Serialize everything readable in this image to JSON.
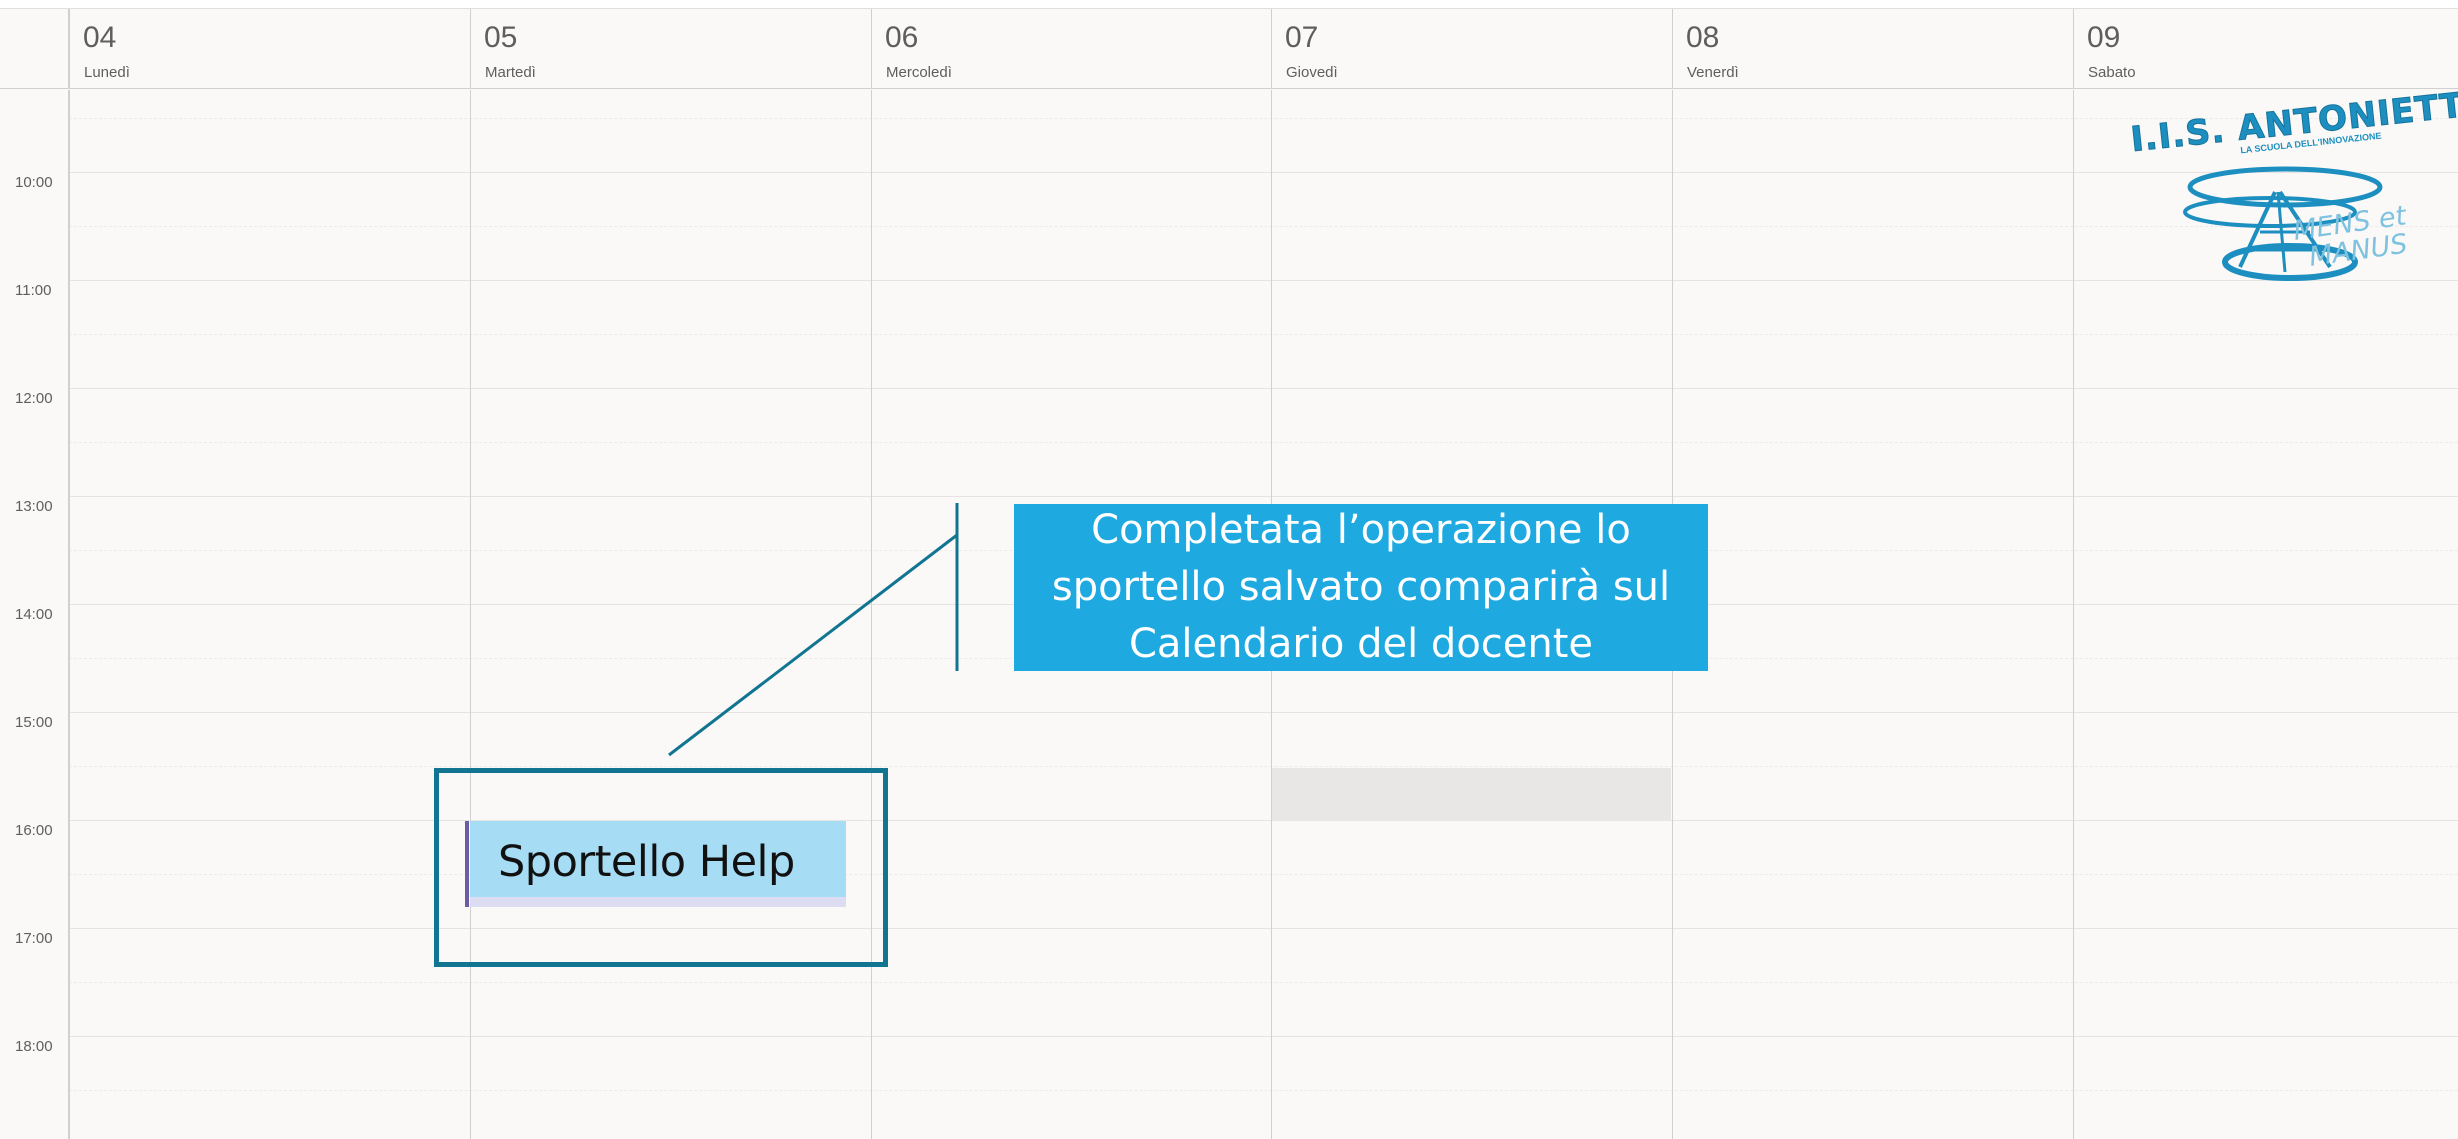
{
  "calendar": {
    "days": [
      {
        "num": "04",
        "name": "Lunedì"
      },
      {
        "num": "05",
        "name": "Martedì"
      },
      {
        "num": "06",
        "name": "Mercoledì"
      },
      {
        "num": "07",
        "name": "Giovedì"
      },
      {
        "num": "08",
        "name": "Venerdì"
      },
      {
        "num": "09",
        "name": "Sabato"
      }
    ],
    "hours": [
      "10:00",
      "11:00",
      "12:00",
      "13:00",
      "14:00",
      "15:00",
      "16:00",
      "17:00",
      "18:00"
    ]
  },
  "event": {
    "title": "Sportello Help",
    "color": "#a6dcf4",
    "accent": "#6b5ca5"
  },
  "callout": {
    "text": "Completata l’operazione lo sportello salvato comparirà sul Calendario del docente",
    "color": "#1ea9e1",
    "highlight_color": "#117592"
  },
  "logo": {
    "title": "I.I.S. ANTONIETTI",
    "subtitle": "LA SCUOLA DELL'INNOVAZIONE",
    "motto_line1": "MENS et",
    "motto_line2": "MANUS"
  }
}
